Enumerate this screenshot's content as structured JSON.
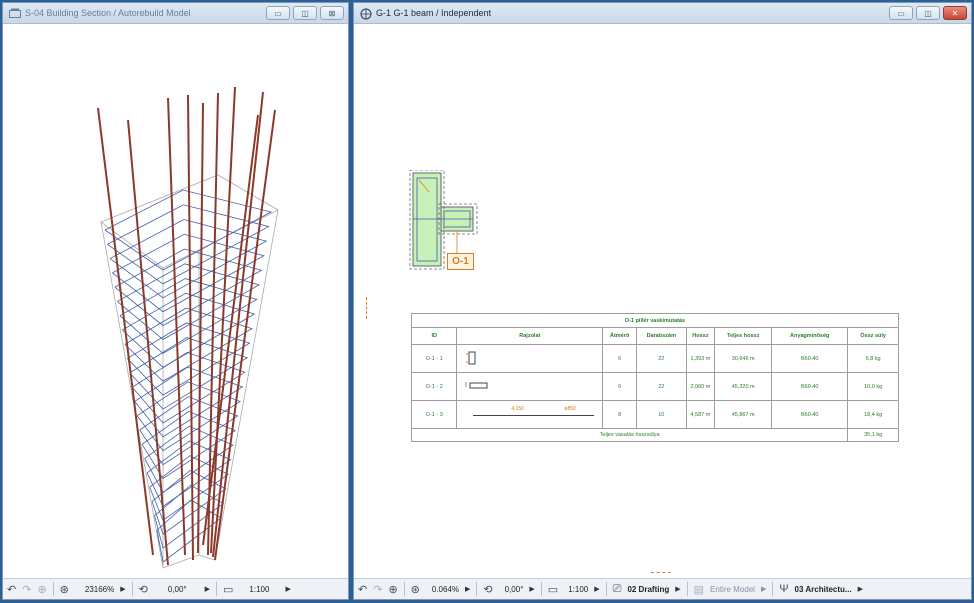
{
  "left_window": {
    "title": "S-04 Building Section / Autorebuild Model",
    "status": {
      "zoom": "23166%",
      "angle": "0,00°",
      "scale": "1:100"
    }
  },
  "right_window": {
    "title": "G-1 G-1 beam / Independent",
    "label_tag": "O-1",
    "status": {
      "zoom": "0.064%",
      "angle": "0,00°",
      "scale": "1:100",
      "layer": "02 Drafting",
      "model_filter": "Entire Model",
      "structure": "03 Architectu..."
    },
    "table": {
      "title": "O-1 pillér vaskimutatás",
      "headers": [
        "ID",
        "Rajzolat",
        "Átmérő",
        "Darabszám",
        "Hossz",
        "Teljes hossz",
        "Anyagminőség",
        "Össz súly"
      ],
      "rows": [
        {
          "id": "O-1 - 1",
          "drawing": "",
          "diameter": "6",
          "count": "22",
          "length": "1,393 m",
          "total_length": "30,646 m",
          "material": "B60.40",
          "weight": "6,8 kg"
        },
        {
          "id": "O-1 - 2",
          "drawing": "",
          "diameter": "6",
          "count": "22",
          "length": "2,060 m",
          "total_length": "45,320 m",
          "material": "B60.40",
          "weight": "10,0 kg"
        },
        {
          "id": "O-1 - 3",
          "drawing": "4.150",
          "drawing_note": "ø850",
          "diameter": "8",
          "count": "10",
          "length": "4,587 m",
          "total_length": "45,867 m",
          "material": "B60.40",
          "weight": "18,4 kg"
        }
      ],
      "footer_label": "Teljes vasalás összsúlya",
      "footer_total": "35,1 kg"
    }
  },
  "colors": {
    "rebar_red": "#8b3a2a",
    "rebar_blue": "#3f5fa8",
    "table_text": "#2a7d2a",
    "section_fill": "#c8f0b8",
    "tag_orange": "#e07a1f"
  }
}
